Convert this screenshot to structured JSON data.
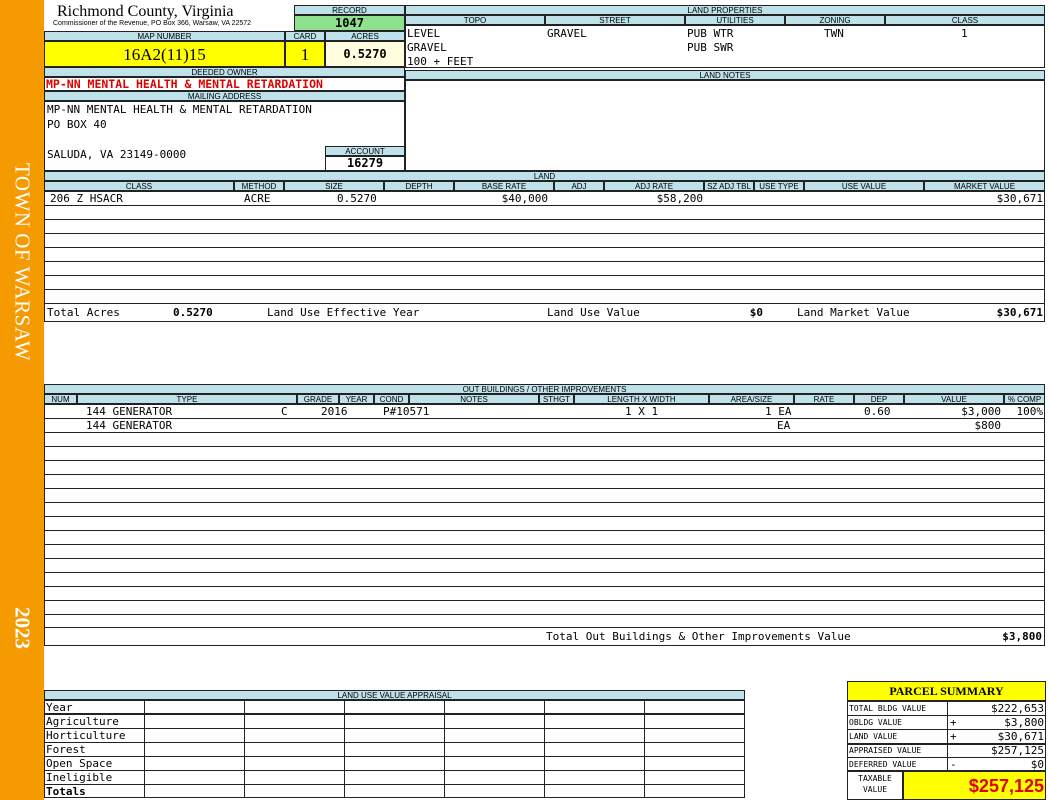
{
  "banner": {
    "town": "TOWN OF WARSAW",
    "year": "2023"
  },
  "header": {
    "county": "Richmond County, Virginia",
    "commissioner": "Commissioner of the Revenue, PO Box 366, Warsaw, VA 22572",
    "record_label": "RECORD",
    "record_value": "1047",
    "map_number_label": "MAP NUMBER",
    "map_number": "16A2(11)15",
    "card_label": "CARD",
    "card": "1",
    "acres_label": "ACRES",
    "acres": "0.5270"
  },
  "owner": {
    "deeded_label": "DEEDED OWNER",
    "deeded_owner": "MP-NN MENTAL HEALTH & MENTAL RETARDATION",
    "mailing_label": "MAILING ADDRESS",
    "address_1": "MP-NN MENTAL HEALTH & MENTAL RETARDATION",
    "address_2": "PO BOX 40",
    "address_3": "SALUDA, VA 23149-0000",
    "account_label": "ACCOUNT",
    "account": "16279"
  },
  "land_properties": {
    "title": "LAND PROPERTIES",
    "headers": [
      "TOPO",
      "STREET",
      "UTILITIES",
      "ZONING",
      "CLASS"
    ],
    "topo": [
      "LEVEL",
      "GRAVEL",
      "100 + FEET"
    ],
    "street": "GRAVEL",
    "utilities": [
      "PUB WTR",
      "PUB SWR"
    ],
    "zoning": "TWN",
    "class": "1"
  },
  "land_notes": {
    "title": "LAND NOTES"
  },
  "land": {
    "title": "LAND",
    "headers": [
      "CLASS",
      "METHOD",
      "SIZE",
      "DEPTH",
      "BASE RATE",
      "ADJ",
      "ADJ RATE",
      "SZ ADJ TBL",
      "USE TYPE",
      "USE VALUE",
      "MARKET VALUE"
    ],
    "row": {
      "class": "206 Z HSACR",
      "method": "ACRE",
      "size": "0.5270",
      "base_rate": "$40,000",
      "adj_rate": "$58,200",
      "market_value": "$30,671"
    },
    "total_acres_label": "Total Acres",
    "total_acres": "0.5270",
    "effective_year_label": "Land Use Effective Year",
    "use_value_label": "Land Use Value",
    "use_value": "$0",
    "market_value_label": "Land Market Value",
    "market_value": "$30,671"
  },
  "outbuildings": {
    "title": "OUT BUILDINGS / OTHER IMPROVEMENTS",
    "headers": [
      "NUM",
      "TYPE",
      "GRADE",
      "YEAR",
      "COND",
      "NOTES",
      "STHGT",
      "LENGTH X WIDTH",
      "AREA/SIZE",
      "RATE",
      "DEP",
      "VALUE",
      "% COMP"
    ],
    "rows": [
      {
        "type": "144 GENERATOR",
        "grade": "C",
        "year": "2016",
        "notes": "P#10571",
        "lxw": "1 X 1",
        "area": "1 EA",
        "dep": "0.60",
        "value": "$3,000",
        "comp": "100%"
      },
      {
        "type": "144 GENERATOR",
        "grade": "",
        "year": "",
        "notes": "",
        "lxw": "",
        "area": "EA",
        "dep": "",
        "value": "$800",
        "comp": ""
      }
    ],
    "total_label": "Total Out Buildings & Other Improvements Value",
    "total": "$3,800"
  },
  "land_use_appraisal": {
    "title": "LAND USE VALUE APPRAISAL",
    "rows": [
      "Year",
      "Agriculture",
      "Horticulture",
      "Forest",
      "Open Space",
      "Ineligible",
      "Totals"
    ]
  },
  "parcel_summary": {
    "title": "PARCEL SUMMARY",
    "rows": [
      {
        "label": "TOTAL BLDG VALUE",
        "op": "",
        "value": "$222,653"
      },
      {
        "label": "OBLDG VALUE",
        "op": "+",
        "value": "$3,800"
      },
      {
        "label": "LAND VALUE",
        "op": "+",
        "value": "$30,671"
      },
      {
        "label": "APPRAISED VALUE",
        "op": "",
        "value": "$257,125"
      },
      {
        "label": "DEFERRED VALUE",
        "op": "-",
        "value": "$0"
      }
    ],
    "taxable_label_1": "TAXABLE",
    "taxable_label_2": "VALUE",
    "taxable_value": "$257,125"
  },
  "colors": {
    "banner": "#f59a00",
    "header_blue": "#bfe1ea",
    "highlight_yellow": "#ffff00",
    "record_green": "#8fe08f",
    "owner_red": "#e00000",
    "taxable_red": "#e00000"
  }
}
